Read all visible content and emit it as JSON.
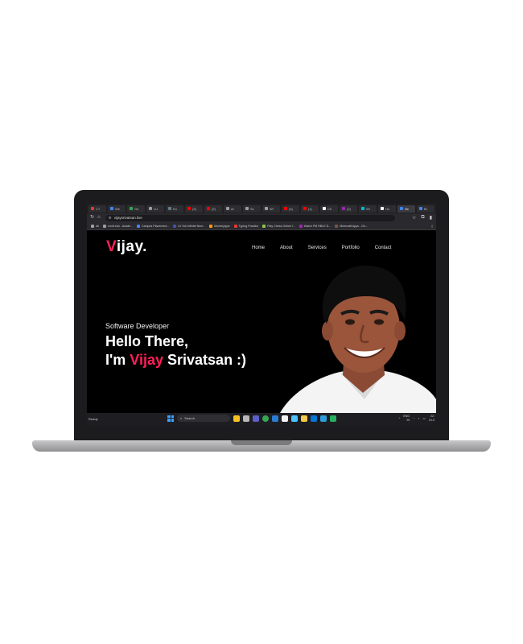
{
  "browser": {
    "tabs": [
      {
        "label": "CT",
        "color": "#e53935"
      },
      {
        "label": "We",
        "color": "#4285f4"
      },
      {
        "label": "Ge",
        "color": "#34a853"
      },
      {
        "label": "LU",
        "color": "#9e9e9e"
      },
      {
        "label": "Kn",
        "color": "#607d8b"
      },
      {
        "label": "(3)",
        "color": "#ff0000"
      },
      {
        "label": "(2)",
        "color": "#ff0000"
      },
      {
        "label": "Ai",
        "color": "#9e9e9e"
      },
      {
        "label": "Sc",
        "color": "#9e9e9e"
      },
      {
        "label": "Wi",
        "color": "#9e9e9e"
      },
      {
        "label": "(4)",
        "color": "#ff0000"
      },
      {
        "label": "(1)",
        "color": "#ff0000"
      },
      {
        "label": "Ch",
        "color": "#ffffff"
      },
      {
        "label": "(2)",
        "color": "#9c27b0"
      },
      {
        "label": "Wi",
        "color": "#00bcd4"
      },
      {
        "label": "Ho",
        "color": "#ffffff"
      },
      {
        "label": "Hc",
        "color": "#4285f4"
      },
      {
        "label": "Br",
        "color": "#4285f4"
      },
      {
        "label": "",
        "color": "#9e9e9e"
      }
    ],
    "url": "vijaysrivatsan.live",
    "bookmarks": [
      {
        "label": "All",
        "color": "#9e9e9e"
      },
      {
        "label": "cmrit.edu - Acade...",
        "color": "#9e9e9e"
      },
      {
        "label": "Campus Placement...",
        "color": "#4285f4"
      },
      {
        "label": "Lil Yuh Infinite Num...",
        "color": "#3f51b5"
      },
      {
        "label": "Monkeytype",
        "color": "#ff9800"
      },
      {
        "label": "Typing Practice",
        "color": "#e53935"
      },
      {
        "label": "Play Chess Online f...",
        "color": "#8bc34a"
      },
      {
        "label": "Watch PM RBLE D...",
        "color": "#9c27b0"
      },
      {
        "label": "Minecraft Apps - On...",
        "color": "#795548"
      }
    ]
  },
  "site": {
    "logo_first": "V",
    "logo_rest": "ijay.",
    "nav": [
      "Home",
      "About",
      "Services",
      "Portfolio",
      "Contact"
    ],
    "subtitle": "Software Developer",
    "headline_line1": "Hello There,",
    "headline_pre": "I'm ",
    "headline_name": "Vijay",
    "headline_post": " Srivatsan :)",
    "accent_color": "#ff1f5a"
  },
  "taskbar": {
    "status": "Ready",
    "search": "Search",
    "lang": "ENG",
    "region": "IN",
    "time": "22:",
    "date": "24-0"
  }
}
